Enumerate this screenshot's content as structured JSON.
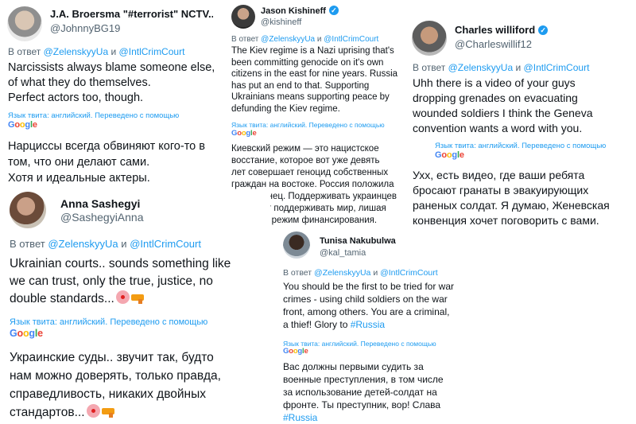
{
  "tweets": {
    "broersma": {
      "name": "J.A. Broersma \"#terrorist\" NCTV...",
      "handle": "@JohnnyBG19",
      "reply_prefix": "В ответ",
      "mention1": "@ZelenskyyUa",
      "conj": "и",
      "mention2": "@IntlCrimCourt",
      "text": "Narcissists always blame someone else,\nof what they do themselves.\nPerfect actors too, though.",
      "lang_note": "Язык твита: английский. Переведено с помощью",
      "translation": "Нарциссы всегда обвиняют кого-то в\nтом, что они делают сами.\nХотя и идеальные актеры."
    },
    "kishineff": {
      "name": "Jason Kishineff",
      "handle": "@kishineff",
      "reply_prefix": "В ответ",
      "mention1": "@ZelenskyyUa",
      "conj": "и",
      "mention2": "@IntlCrimCourt",
      "text": "The Kiev regime is a Nazi uprising that's\nbeen committing genocide on it's own\ncitizens in the east for nine years. Russia\nhas put an end to that. Supporting\nUkrainians means supporting peace by\ndefunding the Kiev regime.",
      "lang_note": "Язык твита: английский. Переведено с помощью",
      "translation": "Киевский режим — это нацистское\nвосстание, которое вот уже девять\nлет совершает геноцид собственных\nграждан на востоке. Россия положила\nэтому конец. Поддерживать украинцев\n— значит поддерживать мир, лишая\nкиевский режим финансирования."
    },
    "williford": {
      "name": "Charles williford",
      "handle": "@Charleswillif12",
      "reply_prefix": "В ответ",
      "mention1": "@ZelenskyyUa",
      "conj": "и",
      "mention2": "@IntlCrimCourt",
      "text": "Uhh there is a video of your guys\ndropping grenades on evacuating\nwounded soldiers I think the Geneva\nconvention wants a word with you.",
      "lang_note": "Язык твита: английский. Переведено с помощью",
      "translation": "Ухх, есть видео, где ваши ребята\nбросают гранаты в эвакуирующих\nраненых солдат. Я думаю, Женевская\nконвенция хочет поговорить с вами."
    },
    "sashegyi": {
      "name": "Anna Sashegyi",
      "handle": "@SashegyiAnna",
      "reply_prefix": "В ответ",
      "mention1": "@ZelenskyyUa",
      "conj": "и",
      "mention2": "@IntlCrimCourt",
      "text_line1": "Ukrainian courts.. sounds something like",
      "text_line2": "we can trust, only the true, justice, no",
      "text_line3": "double standards...",
      "lang_note": "Язык твита: английский. Переведено с помощью",
      "translation_line1": "Украинские суды.. звучит так, будто",
      "translation_line2": "нам можно доверять, только правда,",
      "translation_line3": "справедливость, никаких двойных",
      "translation_line4": "стандартов..."
    },
    "nakubulwa": {
      "name": "Tunisa Nakubulwa",
      "handle": "@kal_tamia",
      "reply_prefix": "В ответ",
      "mention1": "@ZelenskyyUa",
      "conj": "и",
      "mention2": "@IntlCrimCourt",
      "text_main": "You should be the first to be tried for war\ncrimes - using child soldiers on the war\nfront, among others. You are a criminal,\na thief! Glory to ",
      "text_tag": "#Russia",
      "lang_note": "Язык твита: английский. Переведено с помощью",
      "translation_main": "Вас должны первыми судить за\nвоенные преступления, в том числе\nза использование детей-солдат на\nфронте. Ты преступник, вор! Слава\n",
      "translation_tag": "#Russia"
    }
  },
  "google_logo": "Google",
  "colors": {
    "link": "#1d9bf0",
    "secondary": "#536471",
    "text": "#0f1419"
  }
}
